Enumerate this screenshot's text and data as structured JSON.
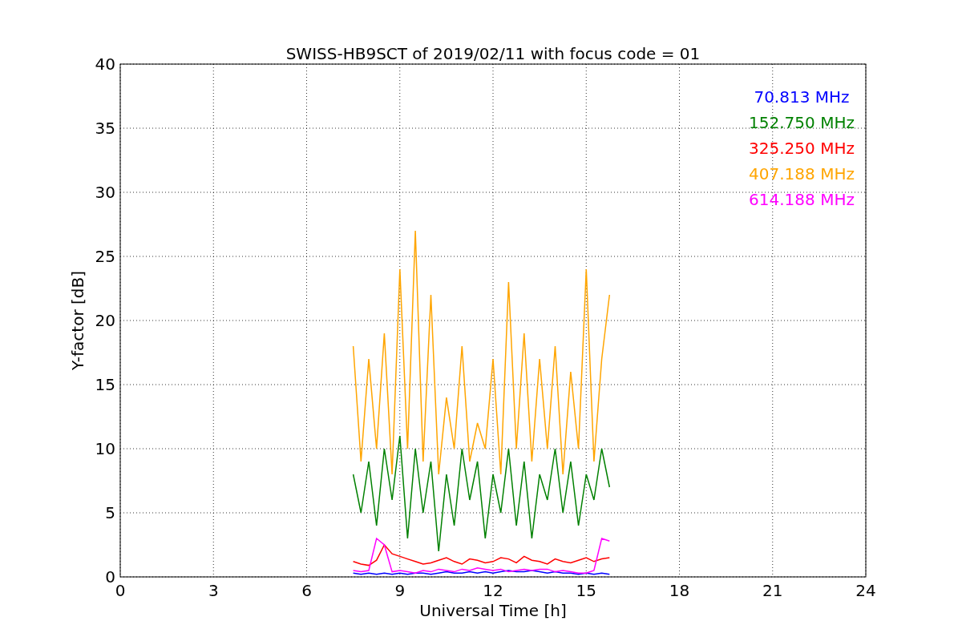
{
  "chart_data": {
    "type": "line",
    "grid": true,
    "title": "SWISS-HB9SCT of 2019/02/11 with focus code = 01",
    "xlabel": "Universal Time [h]",
    "ylabel": "Y-factor [dB]",
    "xlim": [
      0,
      24
    ],
    "ylim": [
      0,
      40
    ],
    "xticks": [
      0,
      3,
      6,
      9,
      12,
      15,
      18,
      21,
      24
    ],
    "yticks": [
      0,
      5,
      10,
      15,
      20,
      25,
      30,
      35,
      40
    ],
    "x": [
      7.5,
      7.75,
      8,
      8.25,
      8.5,
      8.75,
      9,
      9.25,
      9.5,
      9.75,
      10,
      10.25,
      10.5,
      10.75,
      11,
      11.25,
      11.5,
      11.75,
      12,
      12.25,
      12.5,
      12.75,
      13,
      13.25,
      13.5,
      13.75,
      14,
      14.25,
      14.5,
      14.75,
      15,
      15.25,
      15.5,
      15.75
    ],
    "series": [
      {
        "name": "70.813 MHz",
        "color": "#0000ff",
        "values": [
          0.3,
          0.2,
          0.3,
          0.2,
          0.3,
          0.2,
          0.3,
          0.2,
          0.3,
          0.3,
          0.2,
          0.3,
          0.4,
          0.3,
          0.3,
          0.4,
          0.3,
          0.4,
          0.3,
          0.4,
          0.5,
          0.4,
          0.4,
          0.5,
          0.4,
          0.3,
          0.4,
          0.3,
          0.3,
          0.2,
          0.3,
          0.2,
          0.3,
          0.2
        ]
      },
      {
        "name": "152.750 MHz",
        "color": "#008000",
        "values": [
          8,
          5,
          9,
          4,
          10,
          6,
          11,
          3,
          10,
          5,
          9,
          2,
          8,
          4,
          10,
          6,
          9,
          3,
          8,
          5,
          10,
          4,
          9,
          3,
          8,
          6,
          10,
          5,
          9,
          4,
          8,
          6,
          10,
          7
        ]
      },
      {
        "name": "325.250 MHz",
        "color": "#ff0000",
        "values": [
          1.2,
          1,
          0.9,
          1.3,
          2.5,
          1.8,
          1.6,
          1.4,
          1.2,
          1,
          1.1,
          1.3,
          1.5,
          1.2,
          1,
          1.4,
          1.3,
          1.1,
          1.2,
          1.5,
          1.4,
          1.1,
          1.6,
          1.3,
          1.2,
          1,
          1.4,
          1.2,
          1.1,
          1.3,
          1.5,
          1.2,
          1.4,
          1.5
        ]
      },
      {
        "name": "407.188 MHz",
        "color": "#ffa500",
        "values": [
          18,
          9,
          17,
          10,
          19,
          8,
          24,
          10,
          27,
          9,
          22,
          8,
          14,
          10,
          18,
          9,
          12,
          10,
          17,
          8,
          23,
          10,
          19,
          9,
          17,
          10,
          18,
          8,
          16,
          10,
          24,
          9,
          17,
          22
        ]
      },
      {
        "name": "614.188 MHz",
        "color": "#ff00ff",
        "values": [
          0.5,
          0.4,
          0.5,
          3,
          2.5,
          0.4,
          0.5,
          0.4,
          0.3,
          0.5,
          0.4,
          0.6,
          0.5,
          0.4,
          0.6,
          0.5,
          0.7,
          0.6,
          0.5,
          0.6,
          0.4,
          0.5,
          0.6,
          0.5,
          0.6,
          0.6,
          0.4,
          0.5,
          0.4,
          0.3,
          0.3,
          0.5,
          3,
          2.8
        ]
      }
    ]
  }
}
